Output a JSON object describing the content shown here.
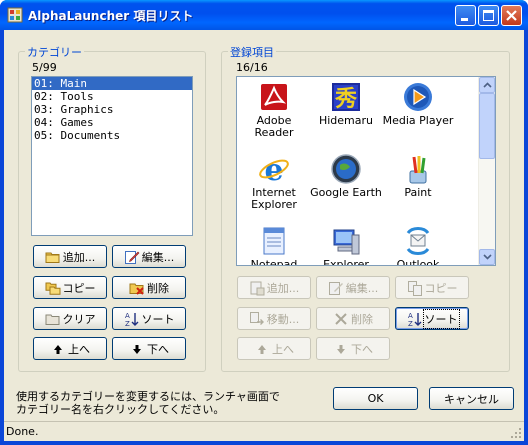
{
  "window": {
    "title": "AlphaLauncher 項目リスト"
  },
  "categories": {
    "title": "カテゴリー",
    "count": "5/99",
    "items": [
      "01: Main",
      "02: Tools",
      "03: Graphics",
      "04: Games",
      "05: Documents"
    ],
    "selected_index": 0,
    "buttons": {
      "add": "追加...",
      "edit": "編集...",
      "copy": "コピー",
      "delete": "削除",
      "clear": "クリア",
      "sort": "ソート",
      "up": "上へ",
      "down": "下へ"
    }
  },
  "entries": {
    "title": "登録項目",
    "count": "16/16",
    "items": [
      {
        "label": "Adobe\nReader",
        "icon": "adobe-reader-icon"
      },
      {
        "label": "Hidemaru",
        "icon": "hidemaru-icon"
      },
      {
        "label": "Media Player",
        "icon": "media-player-icon"
      },
      {
        "label": "Internet\nExplorer",
        "icon": "internet-explorer-icon"
      },
      {
        "label": "Google Earth",
        "icon": "google-earth-icon"
      },
      {
        "label": "Paint",
        "icon": "paint-icon"
      },
      {
        "label": "Notepad",
        "icon": "notepad-icon"
      },
      {
        "label": "Explorer",
        "icon": "explorer-icon"
      },
      {
        "label": "Outlook",
        "icon": "outlook-icon"
      }
    ],
    "buttons": {
      "add": "追加...",
      "edit": "編集...",
      "copy": "コピー",
      "move": "移動...",
      "delete": "削除",
      "sort": "ソート",
      "up": "上へ",
      "down": "下へ"
    }
  },
  "help_text": "使用するカテゴリーを変更するには、ランチャ画面で\nカテゴリー名を右クリックしてください。",
  "dialog_buttons": {
    "ok": "OK",
    "cancel": "キャンセル"
  },
  "status": "Done."
}
